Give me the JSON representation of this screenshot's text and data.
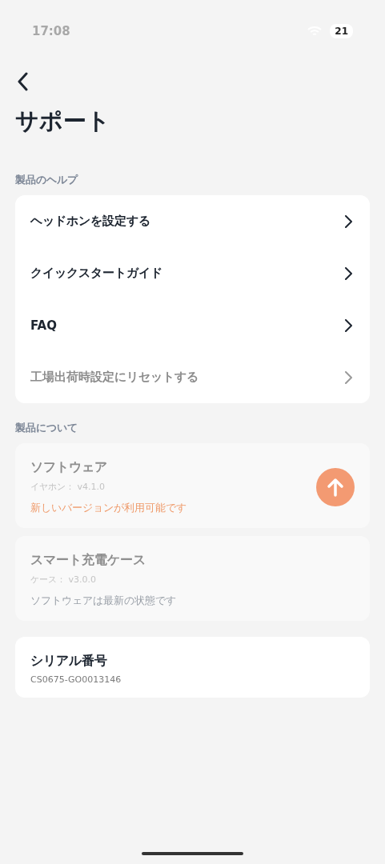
{
  "status_bar": {
    "time": "17:08",
    "battery": "21"
  },
  "title": "サポート",
  "help_section": {
    "label": "製品のヘルプ",
    "items": [
      {
        "label": "ヘッドホンを設定する",
        "disabled": false
      },
      {
        "label": "クイックスタートガイド",
        "disabled": false
      },
      {
        "label": "FAQ",
        "disabled": false
      },
      {
        "label": "工場出荷時設定にリセットする",
        "disabled": true
      }
    ]
  },
  "about_section": {
    "label": "製品について",
    "cards": [
      {
        "title": "ソフトウェア",
        "version": "イヤホン： v4.1.0",
        "status": "新しいバージョンが利用可能です",
        "update_available": true,
        "disabled": true
      },
      {
        "title": "スマート充電ケース",
        "version": "ケース： v3.0.0",
        "status": "ソフトウェアは最新の状態です",
        "update_available": false,
        "disabled": true
      },
      {
        "title": "シリアル番号",
        "version": "CS0675-GO0013146",
        "disabled": false
      }
    ]
  }
}
